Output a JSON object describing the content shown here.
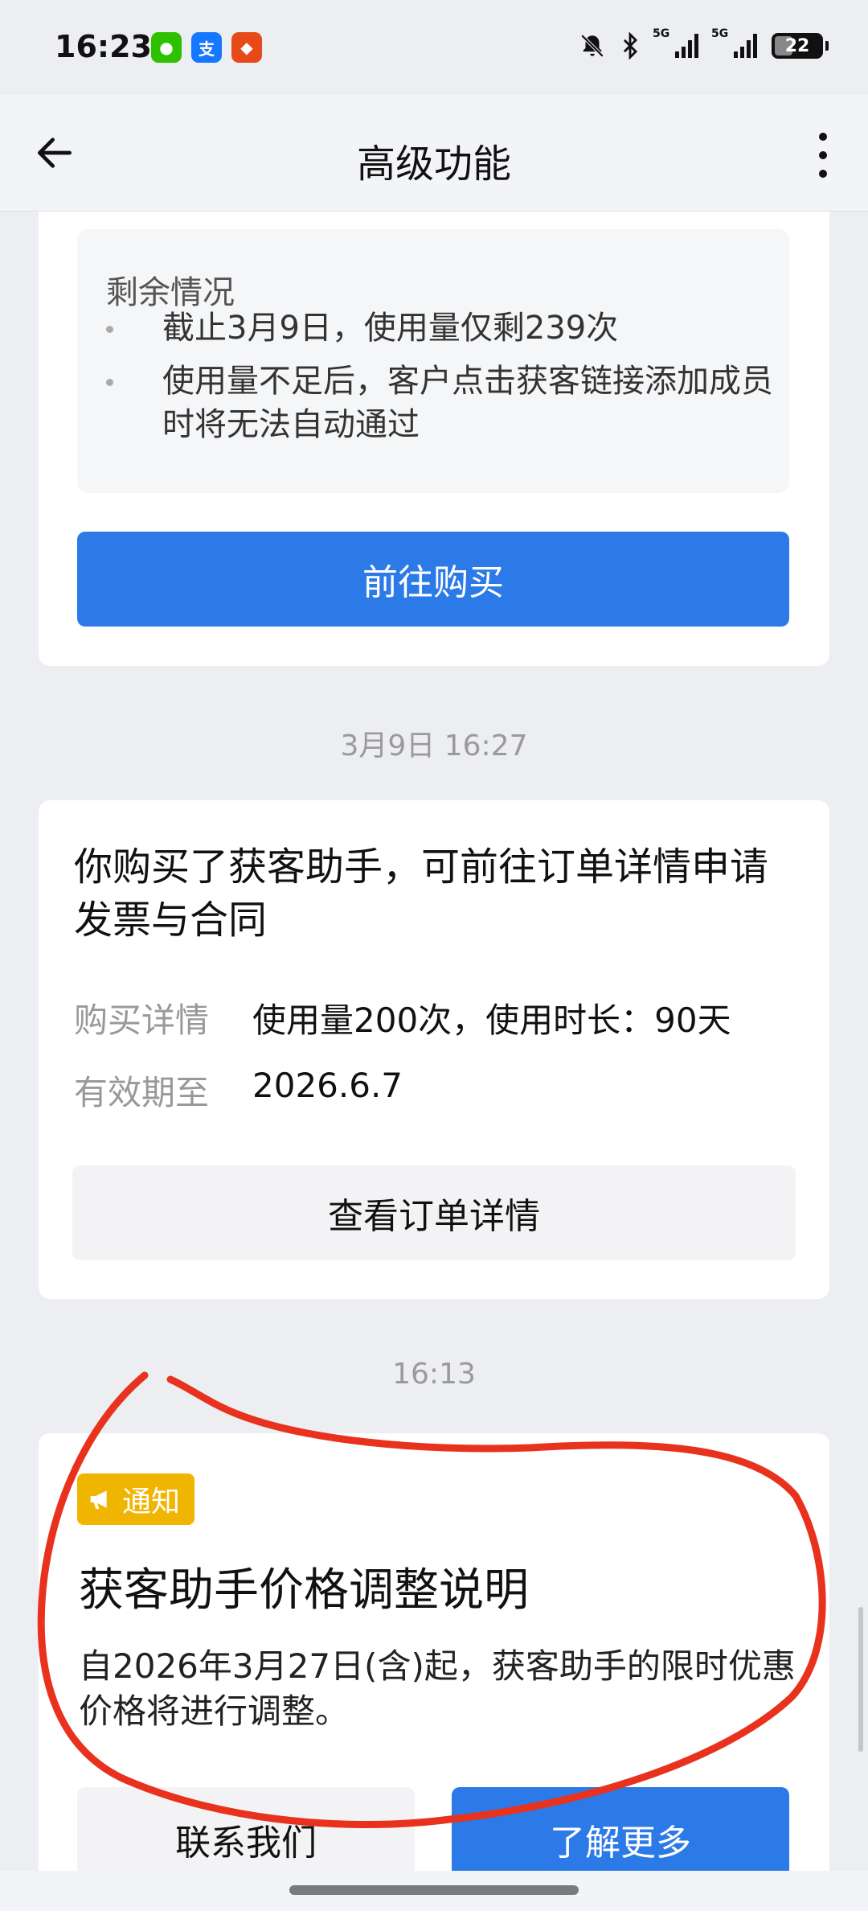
{
  "status_bar": {
    "time": "16:23",
    "apps": [
      {
        "name": "wechat-icon",
        "glyph": "●",
        "color": "#2dc100"
      },
      {
        "name": "alipay-icon",
        "glyph": "支",
        "color": "#1677ff"
      },
      {
        "name": "app-red-icon",
        "glyph": "◆",
        "color": "#e64a19"
      }
    ],
    "network1": "5G",
    "network2": "5G",
    "battery": "22"
  },
  "nav": {
    "title": "高级功能"
  },
  "usage_card": {
    "remain_title": "剩余情况",
    "bullets": [
      "截止3月9日，使用量仅剩239次",
      "使用量不足后，客户点击获客链接添加成员时将无法自动通过"
    ],
    "buy_label": "前往购买"
  },
  "timestamps": [
    "3月9日  16:27",
    "16:13"
  ],
  "order_card": {
    "title": "你购买了获客助手，可前往订单详情申请发票与合同",
    "rows": [
      {
        "label": "购买详情",
        "value": "使用量200次，使用时长：90天"
      },
      {
        "label": "有效期至",
        "value": "2026.6.7"
      }
    ],
    "button_label": "查看订单详情"
  },
  "notice_card": {
    "badge": "通知",
    "title": "获客助手价格调整说明",
    "body": "自2026年3月27日(含)起，获客助手的限时优惠价格将进行调整。",
    "contact_label": "联系我们",
    "learn_label": "了解更多"
  },
  "colors": {
    "primary": "#2c7ae8",
    "badge": "#f0b500",
    "annotation": "#e8321e",
    "background": "#edeef2"
  }
}
